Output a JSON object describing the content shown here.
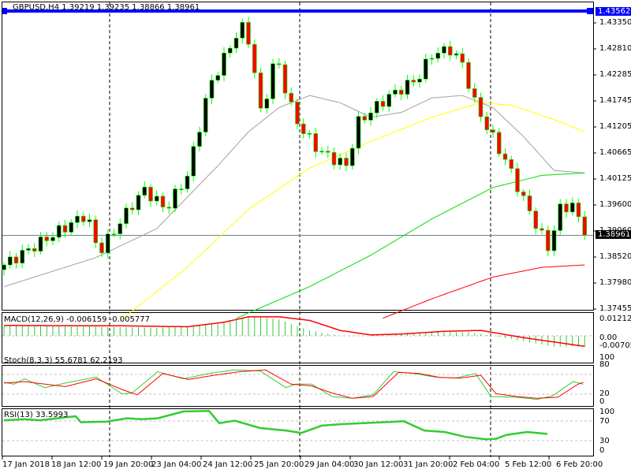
{
  "header": {
    "title": "GBPUSD,H4  1.39219 1.39235 1.38866 1.38961"
  },
  "price_axis": [
    "1.43350",
    "1.42810",
    "1.42285",
    "1.41745",
    "1.41205",
    "1.40665",
    "1.40125",
    "1.39600",
    "1.39060",
    "1.38520",
    "1.37980",
    "1.37455"
  ],
  "current_price": "1.38961",
  "horizontal_line_price": "1.43562",
  "macd": {
    "label": "MACD(12,26,9) -0.006159 -0.005777",
    "axis": [
      "0.012125",
      "0.00",
      "-0.007053"
    ]
  },
  "stoch": {
    "label": "Stoch(8,3,3) 55.6781 62.2193",
    "axis": [
      "100",
      "80",
      "20",
      "0"
    ]
  },
  "rsi": {
    "label": "RSI(13) 33.5993",
    "axis": [
      "100",
      "70",
      "30",
      "0"
    ]
  },
  "time_axis": [
    "17 Jan 2018",
    "18 Jan 12:00",
    "19 Jan 20:00",
    "23 Jan 04:00",
    "24 Jan 12:00",
    "25 Jan 20:00",
    "29 Jan 04:00",
    "30 Jan 12:00",
    "31 Jan 20:00",
    "2 Feb 04:00",
    "5 Feb 12:00",
    "6 Feb 20:00"
  ],
  "colors": {
    "bull": "#000000",
    "bear": "#ff0000",
    "outline": "#00ff00",
    "ma_fast": "#a0a0a0",
    "ma_mid": "#ffff00",
    "ma_slow": "#00dd00",
    "ma_long": "#ff0000"
  },
  "chart_data": {
    "type": "candlestick",
    "price_path": [
      [
        0,
        1.3835
      ],
      [
        13.5,
        1.394
      ],
      [
        15.5,
        1.386
      ],
      [
        21,
        1.396
      ],
      [
        23,
        1.399
      ],
      [
        26.5,
        1.395
      ],
      [
        30,
        1.402
      ],
      [
        31.6,
        1.41
      ],
      [
        33.5,
        1.42
      ],
      [
        35.5,
        1.425
      ],
      [
        38,
        1.431
      ],
      [
        39.4,
        1.433
      ],
      [
        40.4,
        1.428
      ],
      [
        42,
        1.415
      ],
      [
        43,
        1.419
      ],
      [
        44.5,
        1.427
      ],
      [
        46,
        1.42
      ],
      [
        47,
        1.416
      ],
      [
        48.4,
        1.412
      ],
      [
        51.6,
        1.407
      ],
      [
        56,
        1.404
      ],
      [
        58,
        1.413
      ],
      [
        62.6,
        1.418
      ],
      [
        67.7,
        1.422
      ],
      [
        70,
        1.427
      ],
      [
        73,
        1.428
      ],
      [
        75,
        1.425
      ],
      [
        77,
        1.417
      ],
      [
        79,
        1.412
      ],
      [
        82.5,
        1.404
      ],
      [
        85,
        1.397
      ],
      [
        89,
        1.387
      ],
      [
        91,
        1.395
      ],
      [
        93,
        1.396
      ],
      [
        95,
        1.3896
      ]
    ],
    "ma_fast": [
      [
        0,
        1.379
      ],
      [
        15,
        1.385
      ],
      [
        25,
        1.391
      ],
      [
        35,
        1.404
      ],
      [
        40,
        1.411
      ],
      [
        45,
        1.416
      ],
      [
        50,
        1.4185
      ],
      [
        55,
        1.417
      ],
      [
        60,
        1.414
      ],
      [
        65,
        1.415
      ],
      [
        70,
        1.418
      ],
      [
        75,
        1.4185
      ],
      [
        80,
        1.416
      ],
      [
        85,
        1.41
      ],
      [
        90,
        1.403
      ],
      [
        95,
        1.4025
      ]
    ],
    "ma_mid": [
      [
        19,
        1.372
      ],
      [
        30,
        1.383
      ],
      [
        40,
        1.395
      ],
      [
        50,
        1.4035
      ],
      [
        60,
        1.409
      ],
      [
        70,
        1.414
      ],
      [
        78,
        1.417
      ],
      [
        83,
        1.4165
      ],
      [
        90,
        1.4135
      ],
      [
        95,
        1.411
      ]
    ],
    "ma_slow": [
      [
        38,
        1.3725
      ],
      [
        50,
        1.379
      ],
      [
        60,
        1.3855
      ],
      [
        70,
        1.393
      ],
      [
        80,
        1.3995
      ],
      [
        88,
        1.402
      ],
      [
        95,
        1.4025
      ]
    ],
    "ma_long": [
      [
        62,
        1.3725
      ],
      [
        70,
        1.3765
      ],
      [
        80,
        1.381
      ],
      [
        88,
        1.383
      ],
      [
        95,
        1.3835
      ]
    ],
    "macd_hist": [
      [
        0,
        0.0055
      ],
      [
        15,
        0.005
      ],
      [
        25,
        0.0045
      ],
      [
        35,
        0.0065
      ],
      [
        40,
        0.011
      ],
      [
        45,
        0.009
      ],
      [
        50,
        0.003
      ],
      [
        55,
        0
      ],
      [
        60,
        0
      ],
      [
        70,
        0.002
      ],
      [
        76,
        0.002
      ],
      [
        80,
        0
      ],
      [
        85,
        -0.003
      ],
      [
        90,
        -0.006
      ],
      [
        95,
        -0.006
      ]
    ],
    "macd_signal": [
      [
        0,
        0.0057
      ],
      [
        20,
        0.0055
      ],
      [
        30,
        0.005
      ],
      [
        36,
        0.0075
      ],
      [
        40,
        0.0105
      ],
      [
        45,
        0.0105
      ],
      [
        50,
        0.0085
      ],
      [
        55,
        0.003
      ],
      [
        60,
        0.0005
      ],
      [
        65,
        0.001
      ],
      [
        72,
        0.0025
      ],
      [
        78,
        0.003
      ],
      [
        85,
        -0.001
      ],
      [
        95,
        -0.0058
      ]
    ],
    "stoch_main": [
      [
        0,
        60
      ],
      [
        2,
        55
      ],
      [
        4,
        70
      ],
      [
        8,
        45
      ],
      [
        12,
        58
      ],
      [
        18,
        75
      ],
      [
        23,
        28
      ],
      [
        25,
        30
      ],
      [
        30,
        90
      ],
      [
        35,
        70
      ],
      [
        40,
        85
      ],
      [
        45,
        95
      ],
      [
        50,
        92
      ],
      [
        55,
        45
      ],
      [
        57,
        55
      ],
      [
        60,
        55
      ],
      [
        64,
        20
      ],
      [
        68,
        15
      ],
      [
        72,
        25
      ],
      [
        76,
        90
      ],
      [
        80,
        85
      ],
      [
        84,
        75
      ],
      [
        88,
        72
      ],
      [
        92,
        85
      ],
      [
        95,
        20
      ],
      [
        100,
        18
      ],
      [
        104,
        12
      ],
      [
        107,
        22
      ],
      [
        111,
        62
      ],
      [
        113,
        55
      ]
    ],
    "stoch_signal": [
      [
        0,
        58
      ],
      [
        4,
        62
      ],
      [
        8,
        55
      ],
      [
        12,
        48
      ],
      [
        18,
        70
      ],
      [
        23,
        40
      ],
      [
        26,
        25
      ],
      [
        31,
        85
      ],
      [
        36,
        68
      ],
      [
        41,
        80
      ],
      [
        46,
        90
      ],
      [
        51,
        95
      ],
      [
        56,
        55
      ],
      [
        60,
        50
      ],
      [
        64,
        30
      ],
      [
        68,
        15
      ],
      [
        72,
        20
      ],
      [
        77,
        88
      ],
      [
        81,
        85
      ],
      [
        85,
        74
      ],
      [
        89,
        72
      ],
      [
        93,
        80
      ],
      [
        96,
        28
      ],
      [
        100,
        20
      ],
      [
        104,
        15
      ],
      [
        108,
        18
      ],
      [
        112,
        55
      ],
      [
        113,
        60
      ]
    ],
    "rsi": [
      [
        0,
        66
      ],
      [
        4,
        68
      ],
      [
        7,
        66
      ],
      [
        12,
        72
      ],
      [
        14,
        74
      ],
      [
        15,
        62
      ],
      [
        20,
        63
      ],
      [
        24,
        70
      ],
      [
        27,
        68
      ],
      [
        30,
        70
      ],
      [
        35,
        84
      ],
      [
        40,
        85
      ],
      [
        42,
        60
      ],
      [
        45,
        65
      ],
      [
        50,
        50
      ],
      [
        55,
        45
      ],
      [
        58,
        40
      ],
      [
        62,
        55
      ],
      [
        66,
        58
      ],
      [
        70,
        60
      ],
      [
        74,
        62
      ],
      [
        78,
        64
      ],
      [
        82,
        45
      ],
      [
        86,
        42
      ],
      [
        90,
        32
      ],
      [
        94,
        27
      ],
      [
        96,
        28
      ],
      [
        98,
        36
      ],
      [
        102,
        42
      ],
      [
        106,
        38
      ]
    ]
  }
}
